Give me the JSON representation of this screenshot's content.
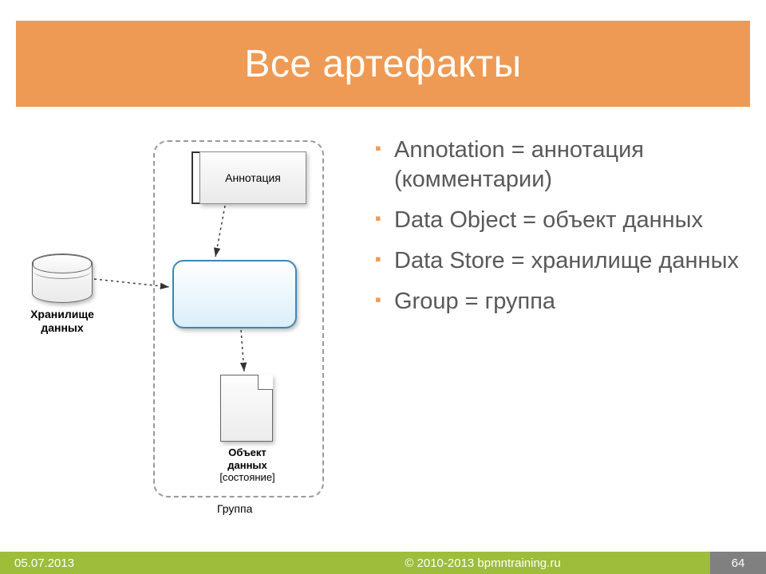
{
  "title": "Все артефакты",
  "bullets": [
    "Annotation = аннотация (комментарии)",
    "Data Object = объект данных",
    "Data Store = хранилище данных",
    "Group = группа"
  ],
  "diagram": {
    "annotation_label": "Аннотация",
    "datastore_label": "Хранилище данных",
    "dataobject_label_bold": "Объект данных",
    "dataobject_label_state": "[состояние]",
    "group_label": "Группа"
  },
  "footer": {
    "date": "05.07.2013",
    "copyright": "© 2010-2013 bpmntraining.ru",
    "page": "64"
  }
}
